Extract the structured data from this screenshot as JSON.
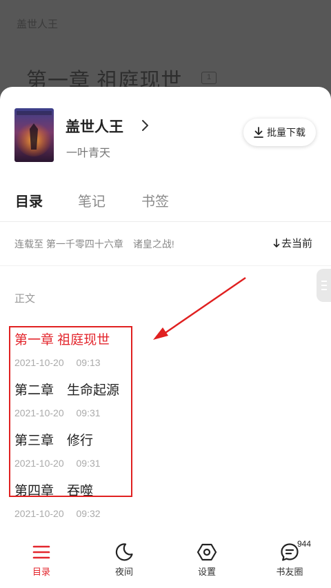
{
  "reader": {
    "book_title": "盖世人王",
    "chapter_title": "第一章 祖庭现世",
    "chapter_badge": "1"
  },
  "book": {
    "title": "盖世人王",
    "author": "一叶青天",
    "cover_text": "盖世人王",
    "batch_download_label": "批量下载"
  },
  "tabs": [
    {
      "label": "目录",
      "active": true
    },
    {
      "label": "笔记",
      "active": false
    },
    {
      "label": "书签",
      "active": false
    }
  ],
  "serial": {
    "text": "连载至 第一千零四十六章　诸皇之战!",
    "goto_label": "去当前"
  },
  "section_label": "正文",
  "chapters": [
    {
      "name": "第一章 祖庭现世",
      "time": "2021-10-20　 09:13",
      "current": true
    },
    {
      "name": "第二章　生命起源",
      "time": "2021-10-20　 09:31",
      "current": false
    },
    {
      "name": "第三章　修行",
      "time": "2021-10-20　 09:31",
      "current": false
    },
    {
      "name": "第四章　吞噬",
      "time": "2021-10-20　 09:32",
      "current": false
    }
  ],
  "bottom_nav": [
    {
      "label": "目录",
      "icon": "menu-icon",
      "active": true
    },
    {
      "label": "夜间",
      "icon": "moon-icon",
      "active": false
    },
    {
      "label": "设置",
      "icon": "settings-hexagon-icon",
      "active": false
    },
    {
      "label": "书友圈",
      "icon": "chat-bubble-icon",
      "active": false
    }
  ],
  "community_badge": "944",
  "colors": {
    "accent": "#e3262d",
    "annotation": "#e02020",
    "overlay": "#575757"
  }
}
